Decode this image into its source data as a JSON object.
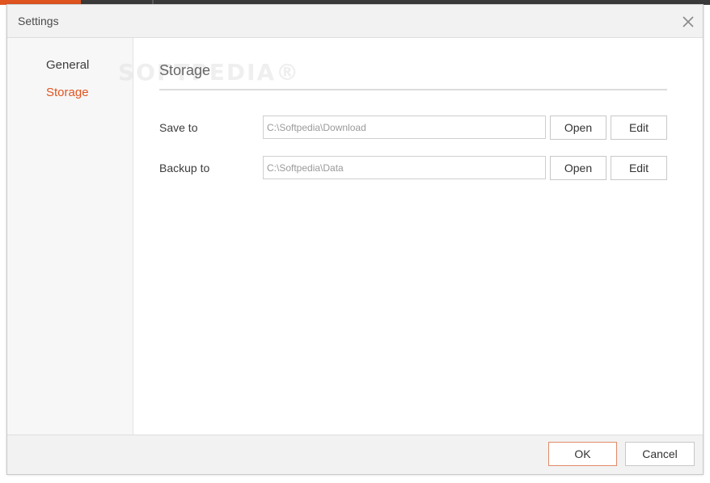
{
  "window": {
    "title": "Settings",
    "close_icon": "close-icon"
  },
  "sidebar": {
    "items": [
      {
        "label": "General",
        "active": false
      },
      {
        "label": "Storage",
        "active": true
      }
    ]
  },
  "main": {
    "section_title": "Storage",
    "watermark": "SOFTPEDIA®",
    "rows": [
      {
        "label": "Save to",
        "path": "C:\\Softpedia\\Download",
        "open_label": "Open",
        "edit_label": "Edit"
      },
      {
        "label": "Backup to",
        "path": "C:\\Softpedia\\Data",
        "open_label": "Open",
        "edit_label": "Edit"
      }
    ]
  },
  "footer": {
    "ok_label": "OK",
    "cancel_label": "Cancel"
  },
  "colors": {
    "accent": "#e0541f",
    "topbar": "#3a3a3a"
  }
}
